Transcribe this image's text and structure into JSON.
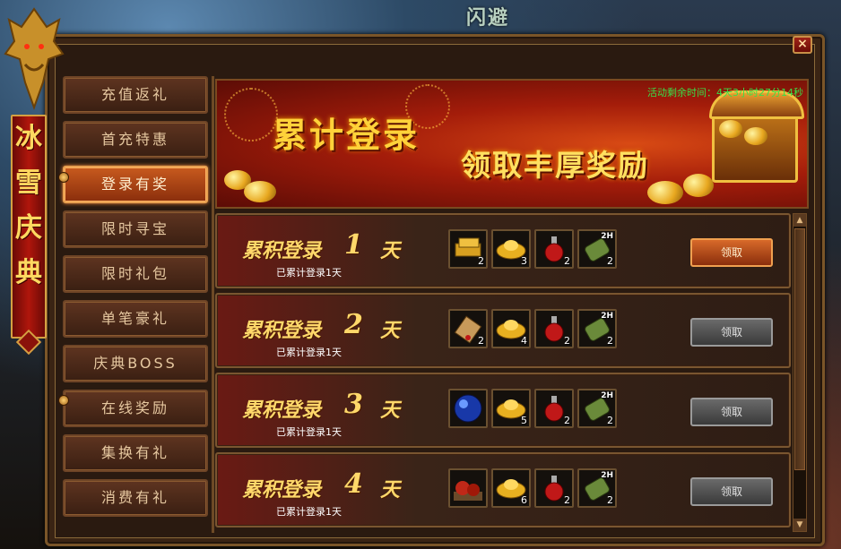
{
  "top_title": "闪避",
  "close_label": "×",
  "banner_vertical": [
    "冰",
    "雪",
    "庆",
    "典"
  ],
  "menu": [
    {
      "label": "充值返礼",
      "active": false
    },
    {
      "label": "首充特惠",
      "active": false
    },
    {
      "label": "登录有奖",
      "active": true
    },
    {
      "label": "限时寻宝",
      "active": false
    },
    {
      "label": "限时礼包",
      "active": false
    },
    {
      "label": "单笔豪礼",
      "active": false
    },
    {
      "label": "庆典BOSS",
      "active": false
    },
    {
      "label": "在线奖励",
      "active": false
    },
    {
      "label": "集换有礼",
      "active": false
    },
    {
      "label": "消费有礼",
      "active": false
    }
  ],
  "header": {
    "title": "累计登录",
    "subtitle": "领取丰厚奖励",
    "timer": "活动剩余时间：4天3小时27分14秒"
  },
  "rows": [
    {
      "title": "累积登录",
      "day": "1",
      "unit": "天",
      "sub": "已累计登录1天",
      "claim": "领取",
      "claimable": true,
      "items": [
        {
          "icon": "gold-bars-icon",
          "count": "2"
        },
        {
          "icon": "gold-ingot-icon",
          "count": "3"
        },
        {
          "icon": "red-potion-icon",
          "count": "2"
        },
        {
          "icon": "exp-scroll-icon",
          "count": "2",
          "tag": "2H"
        }
      ]
    },
    {
      "title": "累积登录",
      "day": "2",
      "unit": "天",
      "sub": "已累计登录1天",
      "claim": "领取",
      "claimable": false,
      "items": [
        {
          "icon": "paper-scroll-icon",
          "count": "2"
        },
        {
          "icon": "gold-ingot-icon",
          "count": "4"
        },
        {
          "icon": "red-potion-icon",
          "count": "2"
        },
        {
          "icon": "exp-scroll-icon",
          "count": "2",
          "tag": "2H"
        }
      ]
    },
    {
      "title": "累积登录",
      "day": "3",
      "unit": "天",
      "sub": "已累计登录1天",
      "claim": "领取",
      "claimable": false,
      "items": [
        {
          "icon": "blue-orb-icon",
          "count": ""
        },
        {
          "icon": "gold-ingot-icon",
          "count": "5"
        },
        {
          "icon": "red-potion-icon",
          "count": "2"
        },
        {
          "icon": "exp-scroll-icon",
          "count": "2",
          "tag": "2H"
        }
      ]
    },
    {
      "title": "累积登录",
      "day": "4",
      "unit": "天",
      "sub": "已累计登录1天",
      "claim": "领取",
      "claimable": false,
      "items": [
        {
          "icon": "red-pellets-icon",
          "count": ""
        },
        {
          "icon": "gold-ingot-icon",
          "count": "6"
        },
        {
          "icon": "red-potion-icon",
          "count": "2"
        },
        {
          "icon": "exp-scroll-icon",
          "count": "2",
          "tag": "2H"
        }
      ]
    }
  ],
  "colors": {
    "accent": "#ffd86a",
    "active_menu": "#c85a1e",
    "timer": "#38e048"
  }
}
